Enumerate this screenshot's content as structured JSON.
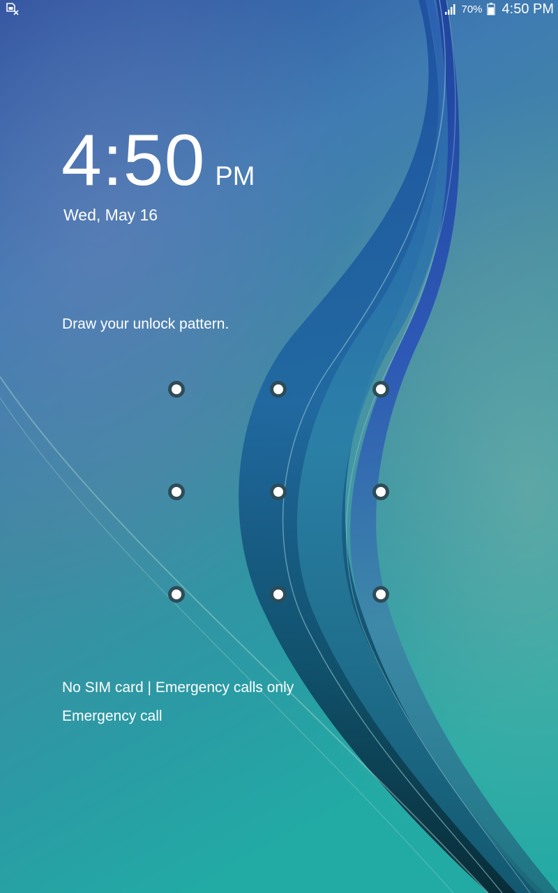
{
  "status_bar": {
    "left_icon": "no-sim-icon",
    "signal_icon": "signal-icon",
    "battery_percent": "70%",
    "battery_icon": "battery-icon",
    "time": "4:50 PM"
  },
  "clock": {
    "time": "4:50",
    "ampm": "PM",
    "date": "Wed, May 16"
  },
  "unlock": {
    "instruction": "Draw your unlock pattern.",
    "grid_rows": 3,
    "grid_cols": 3
  },
  "footer": {
    "carrier_status": "No SIM card | Emergency calls only",
    "emergency_call_label": "Emergency call"
  },
  "colors": {
    "background_top": "#2a57a0",
    "background_bottom": "#26a9a6",
    "dot_ring": "#2d4c58",
    "text": "#ffffff"
  }
}
